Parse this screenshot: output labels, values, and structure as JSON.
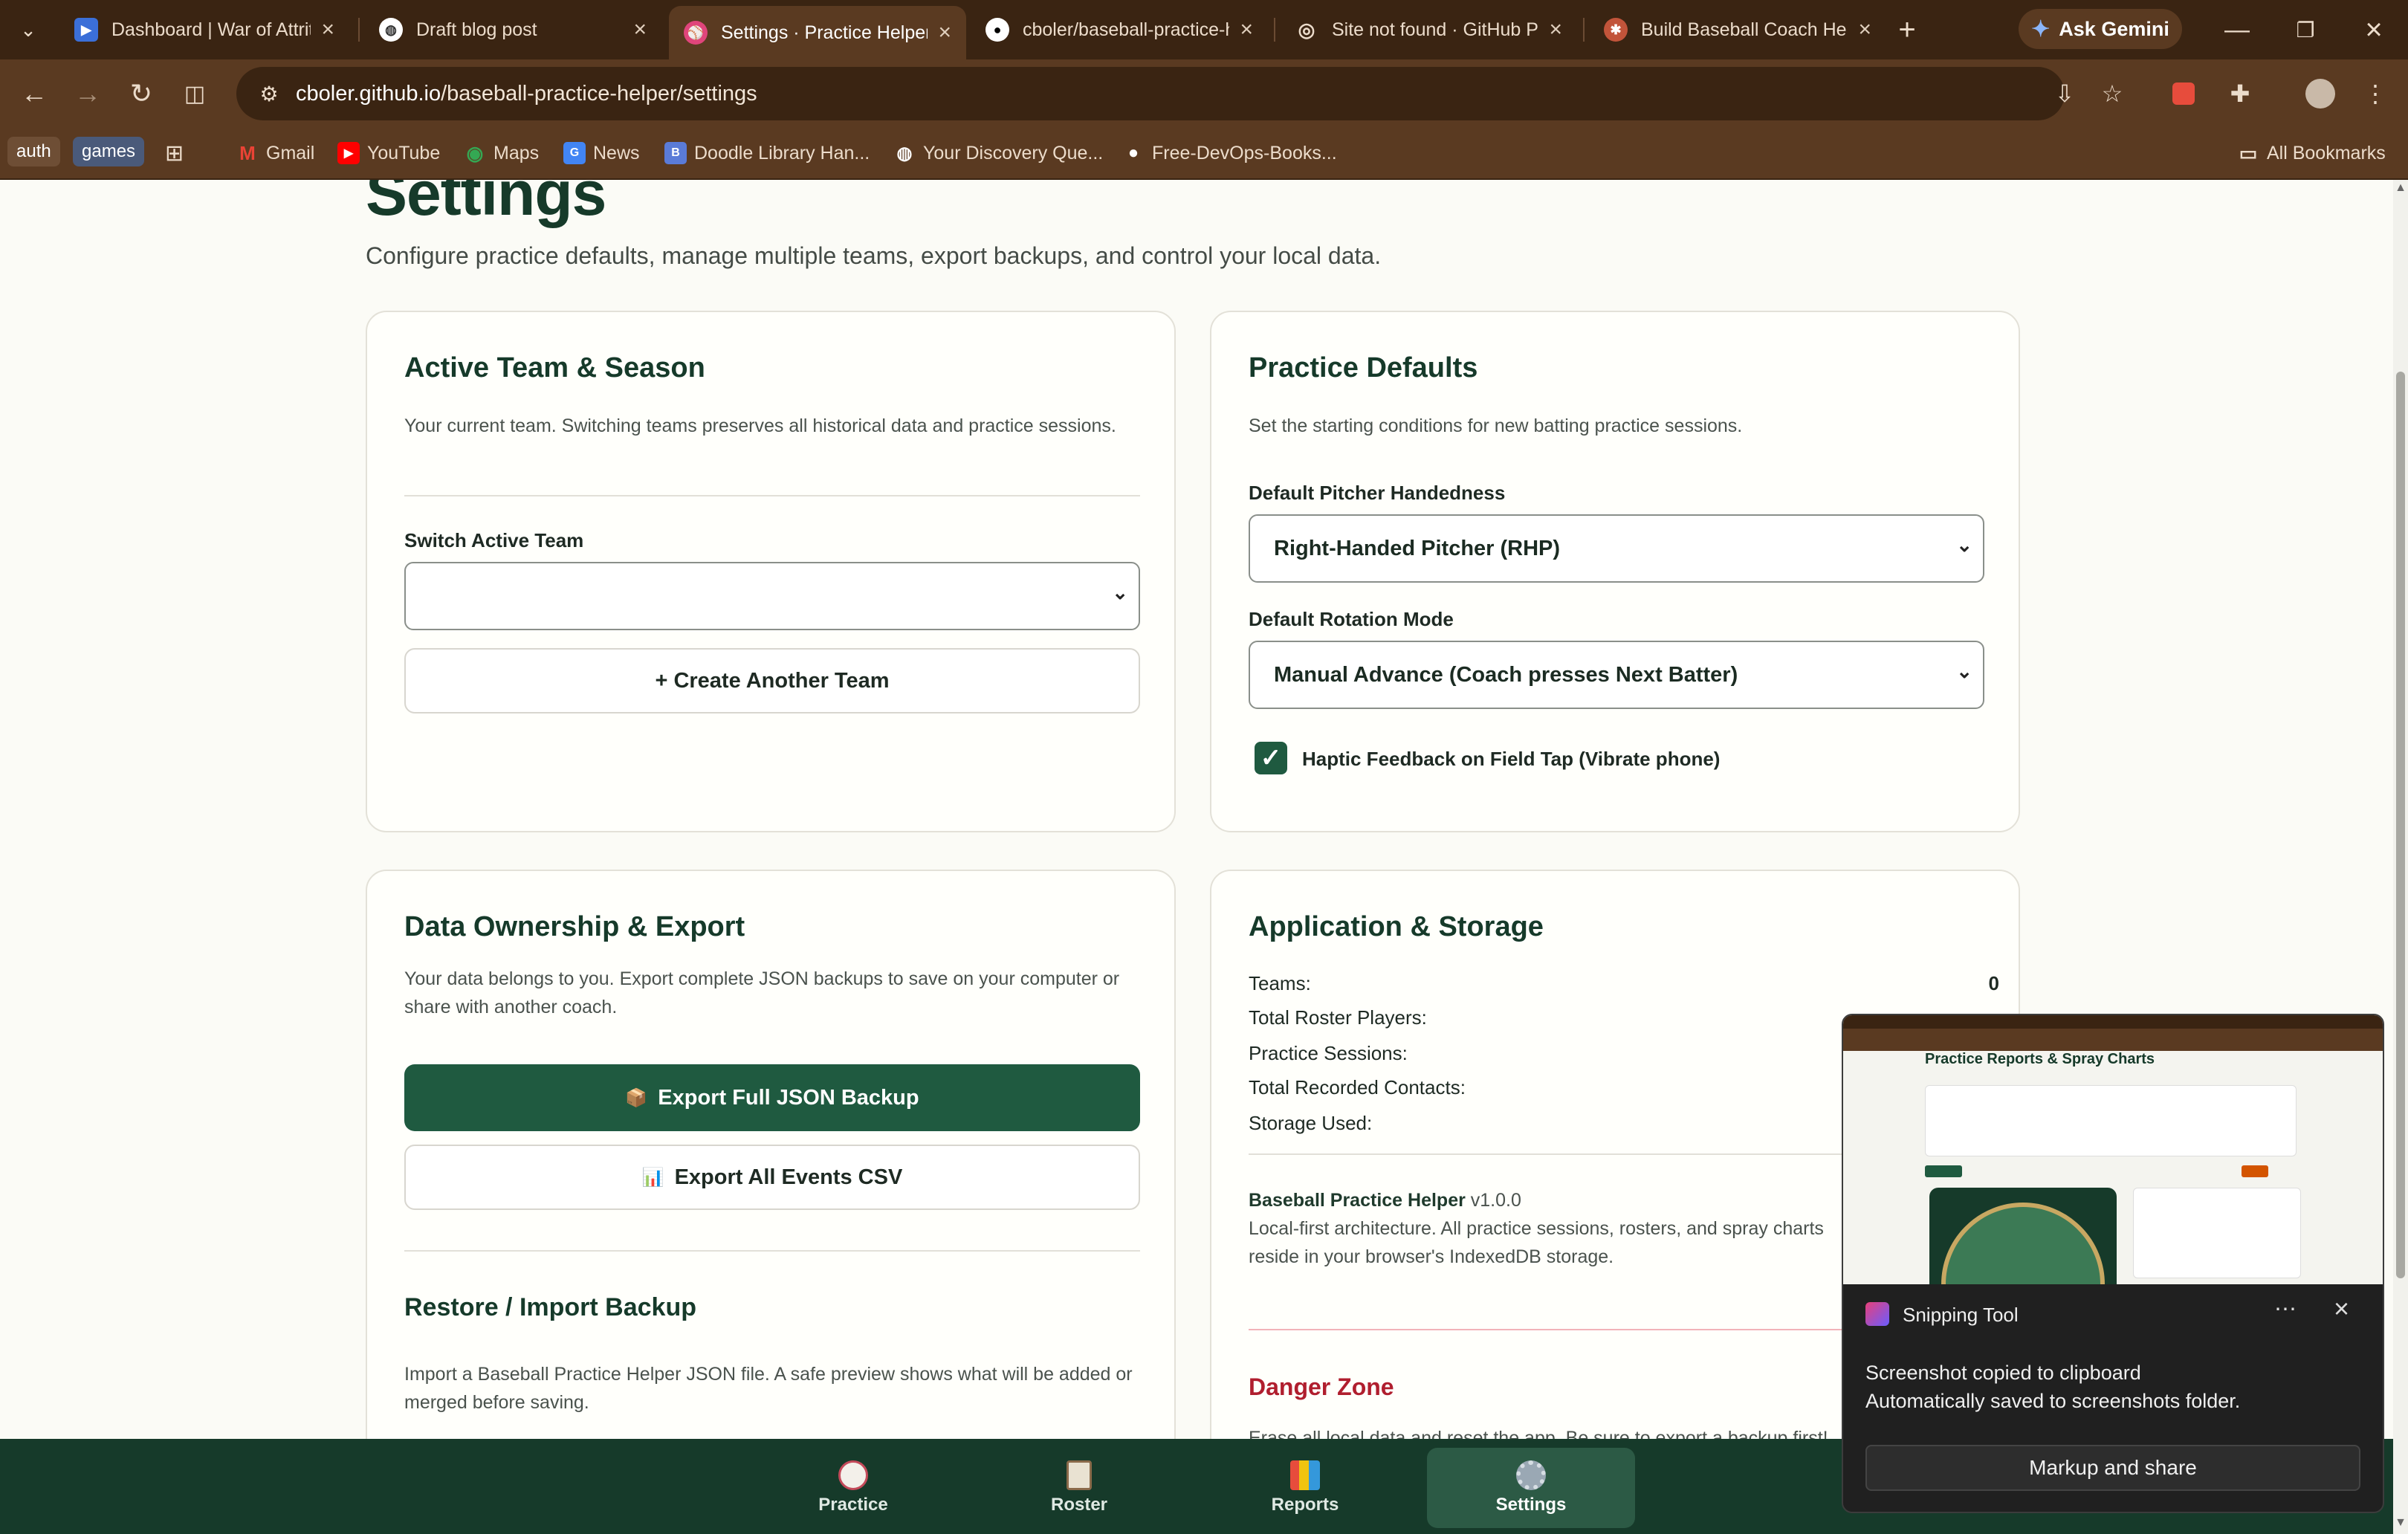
{
  "browser": {
    "tabs": [
      {
        "title": "Dashboard | War of Attrition",
        "active": false
      },
      {
        "title": "Draft blog post",
        "active": false
      },
      {
        "title": "Settings · Practice Helper",
        "active": true
      },
      {
        "title": "cboler/baseball-practice-helper",
        "active": false
      },
      {
        "title": "Site not found · GitHub Pages",
        "active": false
      },
      {
        "title": "Build Baseball Coach Helper",
        "active": false
      }
    ],
    "gemini_label": "Ask Gemini",
    "url_host": "cboler.github.io",
    "url_path": "/baseball-practice-helper/settings",
    "bookmarks": {
      "auth": "auth",
      "games": "games",
      "gmail": "Gmail",
      "youtube": "YouTube",
      "maps": "Maps",
      "news": "News",
      "doodle": "Doodle Library Han...",
      "discovery": "Your Discovery Que...",
      "devops": "Free-DevOps-Books...",
      "all": "All Bookmarks"
    }
  },
  "page": {
    "title": "Settings",
    "subtitle": "Configure practice defaults, manage multiple teams, export backups, and control your local data."
  },
  "active_team": {
    "heading": "Active Team & Season",
    "description": "Your current team. Switching teams preserves all historical data and practice sessions.",
    "switch_label": "Switch Active Team",
    "switch_value": "",
    "create_button": "+ Create Another Team"
  },
  "practice_defaults": {
    "heading": "Practice Defaults",
    "description": "Set the starting conditions for new batting practice sessions.",
    "pitcher_label": "Default Pitcher Handedness",
    "pitcher_value": "Right-Handed Pitcher (RHP)",
    "rotation_label": "Default Rotation Mode",
    "rotation_value": "Manual Advance (Coach presses Next Batter)",
    "haptic_label": "Haptic Feedback on Field Tap (Vibrate phone)",
    "haptic_checked": true
  },
  "data_export": {
    "heading": "Data Ownership & Export",
    "description": "Your data belongs to you. Export complete JSON backups to save on your computer or share with another coach.",
    "json_button": "Export Full JSON Backup",
    "csv_button": "Export All Events CSV",
    "restore_heading": "Restore / Import Backup",
    "restore_description": "Import a Baseball Practice Helper JSON file. A safe preview shows what will be added or merged before saving."
  },
  "storage": {
    "heading": "Application & Storage",
    "stats": [
      {
        "label": "Teams:",
        "value": "0"
      },
      {
        "label": "Total Roster Players:",
        "value": ""
      },
      {
        "label": "Practice Sessions:",
        "value": ""
      },
      {
        "label": "Total Recorded Contacts:",
        "value": ""
      },
      {
        "label": "Storage Used:",
        "value": ""
      }
    ],
    "app_name": "Baseball Practice Helper",
    "version": "v1.0.0",
    "architecture": "Local-first architecture. All practice sessions, rosters, and spray charts reside in your browser's IndexedDB storage.",
    "danger_heading": "Danger Zone",
    "danger_description": "Erase all local data and reset the app. Be sure to export a backup first!"
  },
  "bottom_nav": [
    {
      "label": "Practice",
      "active": false
    },
    {
      "label": "Roster",
      "active": false
    },
    {
      "label": "Reports",
      "active": false
    },
    {
      "label": "Settings",
      "active": true
    }
  ],
  "snipping_tool": {
    "title": "Snipping Tool",
    "message_line1": "Screenshot copied to clipboard",
    "message_line2": "Automatically saved to screenshots folder.",
    "button": "Markup and share",
    "preview_heading": "Practice Reports & Spray Charts"
  },
  "colors": {
    "brand_green": "#1f5a40",
    "nav_green": "#163a2a",
    "danger_red": "#b01e2e",
    "chrome_brown": "#5a3a21"
  }
}
